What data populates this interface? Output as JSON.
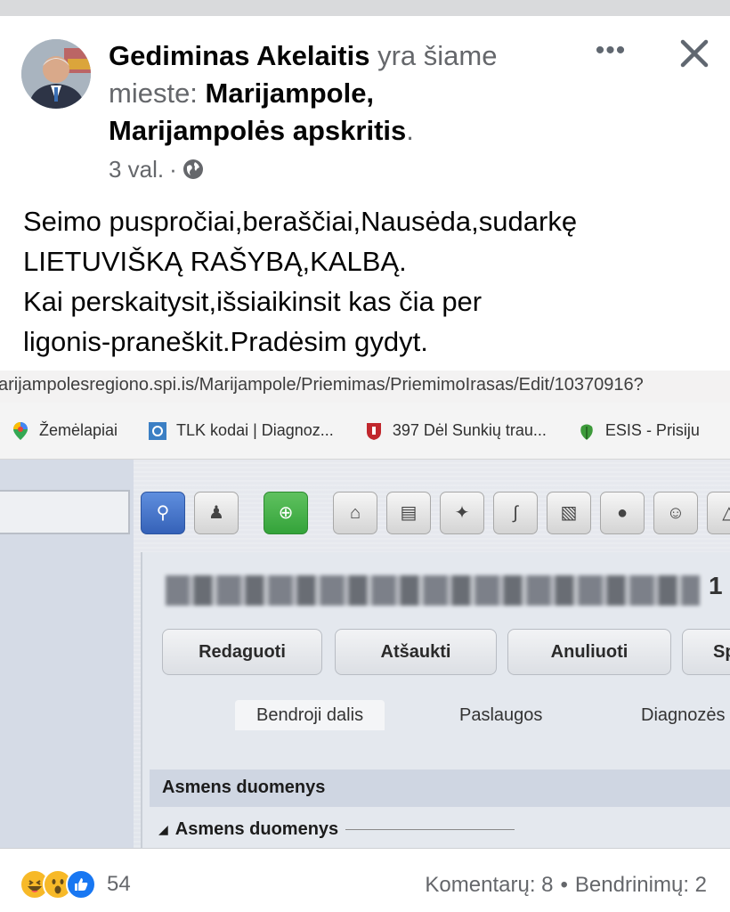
{
  "header": {
    "author": "Gediminas Akelaitis",
    "location_prefix_1": "yra šiame",
    "location_prefix_2": "mieste:",
    "location_1": "Marijampole,",
    "location_2": "Marijampolės apskritis",
    "trailing": ".",
    "time": "3 val.",
    "separator": "·",
    "more_label": "•••"
  },
  "post_text": [
    "Seimo puspročiai,beraščiai,Nausėda,sudarkę",
    "LIETUVIŠKĄ RAŠYBĄ,KALBĄ.",
    "Kai perskaitysit,išsiaikinsit kas čia per",
    "ligonis-praneškit.Pradėsim gydyt."
  ],
  "photo": {
    "url": "arijampolesregiono.spi.is/Marijampole/Priemimas/PriemimoIrasas/Edit/10370916?",
    "bookmarks": [
      {
        "label": "Žemėlapiai",
        "icon": "maps-pin-icon"
      },
      {
        "label": "TLK kodai | Diagnoz...",
        "icon": "tlk-icon"
      },
      {
        "label": "397 Dėl Sunkių trau...",
        "icon": "coat-of-arms-icon"
      },
      {
        "label": "ESIS - Prisiju",
        "icon": "leaf-icon"
      }
    ],
    "title_suffix": "1",
    "buttons": [
      "Redaguoti",
      "Atšaukti",
      "Anuliuoti",
      "Sp"
    ],
    "tabs": [
      "Bendroji dalis",
      "Paslaugos",
      "Diagnozės"
    ],
    "section": "Asmens duomenys",
    "subsection": "Asmens duomenys"
  },
  "footer": {
    "reaction_count": "54",
    "comments": "Komentarų: 8",
    "shares": "Bendrinimų: 2",
    "dot": "•"
  },
  "colors": {
    "muted": "#65676b",
    "like_blue": "#1877f2",
    "haha_yellow": "#f7b928"
  }
}
